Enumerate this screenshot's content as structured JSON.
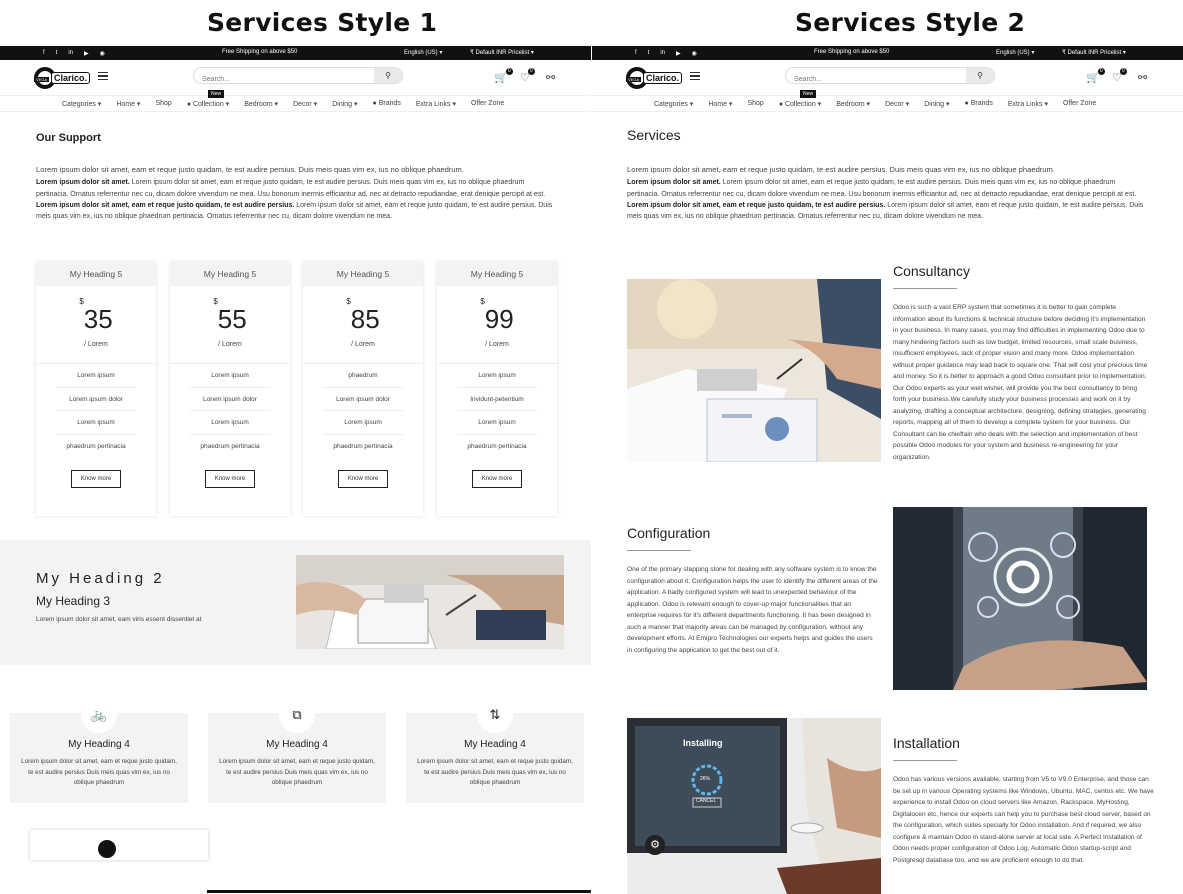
{
  "titles": {
    "left": "Services Style 1",
    "right": "Services Style 2"
  },
  "topbar": {
    "socials": [
      "f",
      "t",
      "in",
      "▶",
      "◉"
    ],
    "shipping": "Free Shipping on above $50",
    "language": "English (US) ▾",
    "pricelist": "₹ Default INR Pricelist ▾"
  },
  "header": {
    "logo_text": "Clarico.",
    "logo_sub": "VEGA",
    "search_placeholder": "Search...",
    "cart_count": "0",
    "wishlist_count": "0"
  },
  "nav": {
    "items": [
      "Categories ▾",
      "Home ▾",
      "Shop",
      "● Collection ▾",
      "Bedroom ▾",
      "Decor ▾",
      "Dining ▾",
      "● Brands",
      "Extra Links ▾",
      "Offer Zone"
    ],
    "new_badge": "New"
  },
  "left": {
    "section_title": "Our Support",
    "lorem": {
      "line1": "Lorem ipsum dolor sit amet, eam et reque justo quidam, te est audire persius. Duis meis quas vim ex, ius no oblique phaedrum.",
      "para2_bold": "Lorem ipsum dolor sit amet.",
      "para2_rest": " Lorem ipsum dolor sit amet, eam et reque justo quidam, te est audire persius. Duis meis quas vim ex, ius no oblique phaedrum pertinacia. Ornatus referrentur nec cu, dicam dolore vivendum ne mea. Usu bonorum inermis efficiantur ad, nec at detracto repudiandae, erat denique percipit at est.",
      "para3_bold": "Lorem ipsum dolor sit amet, eam et reque justo quidam, te est audire persius.",
      "para3_rest": " Lorem ipsum dolor sit amet, eam et reque justo quidam, te est audire persius. Duis meis quas vim ex, ius no oblique phaedrum pertinacia. Ornatus referrentur nec cu, dicam dolore vivendum ne mea."
    },
    "cards": [
      {
        "heading": "My Heading 5",
        "currency": "$",
        "price": "35",
        "per": "/ Lorem",
        "features": [
          "Lorem ipsum",
          "Lorem ipsum dolor",
          "Lorem ipsum",
          "phaedrum pertinacia"
        ],
        "button": "Know more"
      },
      {
        "heading": "My Heading 5",
        "currency": "$",
        "price": "55",
        "per": "/ Lorem",
        "features": [
          "Lorem ipsum",
          "Lorem ipsum dolor",
          "Lorem ipsum",
          "phaedrum pertinacia"
        ],
        "button": "Know more"
      },
      {
        "heading": "My Heading 5",
        "currency": "$",
        "price": "85",
        "per": "/ Lorem",
        "features": [
          "phaedrum",
          "Lorem ipsum dolor",
          "Lorem ipsum",
          "phaedrum pertinacia"
        ],
        "button": "Know more"
      },
      {
        "heading": "My Heading 5",
        "currency": "$",
        "price": "99",
        "per": "/ Lorem",
        "features": [
          "Lorem ipsum",
          "Invidunt-petentium",
          "Lorem ipsum",
          "phaedrum pertinacia"
        ],
        "button": "Know more"
      }
    ],
    "banner": {
      "h2": "My Heading 2",
      "h3": "My Heading 3",
      "text": "Lorem ipsum dolor sit amet, eam viris essent dissentiet at"
    },
    "features": [
      {
        "icon": "bicycle-icon",
        "heading": "My Heading 4",
        "text": "Lorem ipsum dolor sit amet, eam et reque justo quidam, te est audire persius Duis meis quas vim ex, ius no oblique phaedrum"
      },
      {
        "icon": "copy-icon",
        "heading": "My Heading 4",
        "text": "Lorem ipsum dolor sit amet, eam et reque justo quidam, te est audire persius Duis meis quas vim ex, ius no oblique phaedrum"
      },
      {
        "icon": "sort-icon",
        "heading": "My Heading 4",
        "text": "Lorem ipsum dolor sit amet, eam et reque justo quidam, te est audire persius Duis meis quas vim ex, ius no oblique phaedrum"
      }
    ]
  },
  "right": {
    "section_title": "Services",
    "services": [
      {
        "title": "Consultancy",
        "text": "Odoo is such a vast ERP system that sometimes it is better to gain complete information about its functions & technical structure before deciding it's implementation in your business. In many cases, you may find difficulties in implementing Odoo due to many hindering factors such as low budget, limited resources, small scale business, insufficient employees, lack of proper vision and many more. Odoo implementation without proper guidance may lead back to square one. That will cost your precious time and money. So it is better to approach a good Odoo consultant prior to implementation. Our Odoo experts as your well wisher, will provide you the best consultancy to bring forth your business.We carefully study your business processes and work on it by analyzing, drafting a conceptual architecture, designing, defining strategies, generating reports, mapping all of them to develop a complete system for your business. Our Consultant can be chieftain who deals with the selection and implementation of best possible Odoo modules for your system and business re-engineering for your organization."
      },
      {
        "title": "Configuration",
        "text": "One of the primary stepping stone for dealing with any software system is to know the configuration about it. Configuration helps the user to identify the different areas of the application. A badly configured system will lead to unexpected behaviour of the application. Odoo is relevant enough to cover-up major functionalities that an enterprise requires for it's different departments functioning. It has been designed in such a manner that majority areas can be managed by configuration, without any development efforts. At Emipro Technologies our experts helps and guides the users in configuring the application to get the best out of it."
      },
      {
        "title": "Installation",
        "text": "Odoo has various versions available, starting from V5 to V9.0 Enterprise, and those can be set up in various Operating systems like Windows, Ubuntu, MAC, centos etc. We have experience to install Odoo on cloud servers like Amazon, Rackspace, MyHosting, Digitalocen etc, hence our experts can help you to purchase best cloud server, based on the configuration, which suites specially for Odoo installation. And if required, we also configure & maintain Odoo in stand-alone server at local side. A Perfect Installation of Odoo needs proper configuration of Odoo Log, Automatic Odoo startup-script and Postgresql database too, and we are proficient enough to do that."
      }
    ],
    "install_screen": {
      "heading": "Installing",
      "percent": "26%",
      "cancel": "CANCEL"
    }
  }
}
